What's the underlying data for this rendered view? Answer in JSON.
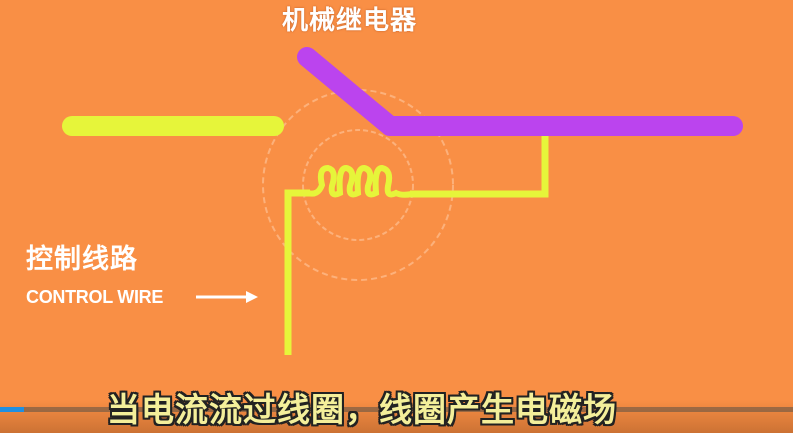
{
  "title": "机械继电器",
  "control_wire": {
    "label_cn": "控制线路",
    "label_en": "CONTROL WIRE"
  },
  "subtitle": "当电流流过线圈，线圈产生电磁场",
  "player": {
    "progress_percent": 3
  },
  "colors": {
    "background": "#f98f45",
    "wire": "#e6f53a",
    "armature": "#bb44ee",
    "progress": "#1f8fe0"
  }
}
